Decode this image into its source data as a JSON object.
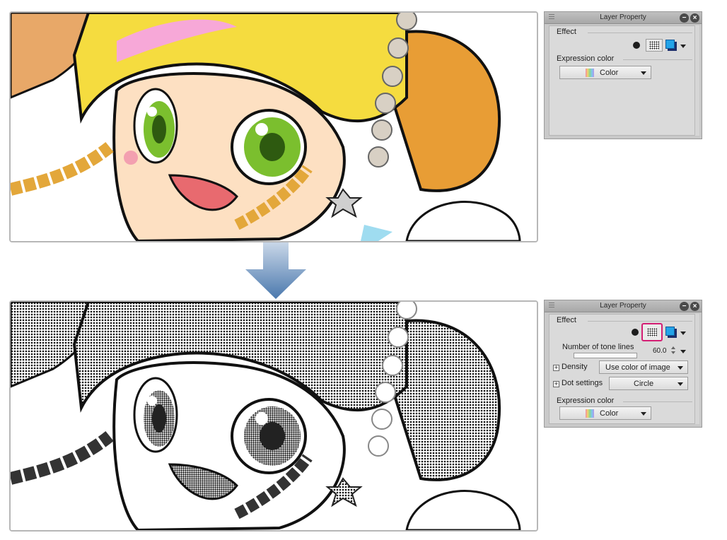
{
  "panel_top": {
    "title": "Layer Property",
    "effect_label": "Effect",
    "expression_color_label": "Expression color",
    "expression_color_value": "Color"
  },
  "panel_bottom": {
    "title": "Layer Property",
    "effect_label": "Effect",
    "tone_lines_label": "Number of tone lines",
    "tone_lines_value": "60.0",
    "density_label": "Density",
    "density_value": "Use color of image",
    "dot_settings_label": "Dot settings",
    "dot_settings_value": "Circle",
    "expression_color_label": "Expression color",
    "expression_color_value": "Color"
  },
  "icons": {
    "effect_dot": "circle-effect-icon",
    "effect_tone": "tone-effect-icon",
    "effect_color": "layer-color-icon",
    "menu": "panel-menu-icon",
    "minimize": "minimize-icon",
    "close": "close-icon"
  },
  "colors": {
    "highlight": "#d41e74",
    "arrow": "#5b86b8",
    "hair": "#f5dc3f",
    "eye": "#6aab1f"
  }
}
